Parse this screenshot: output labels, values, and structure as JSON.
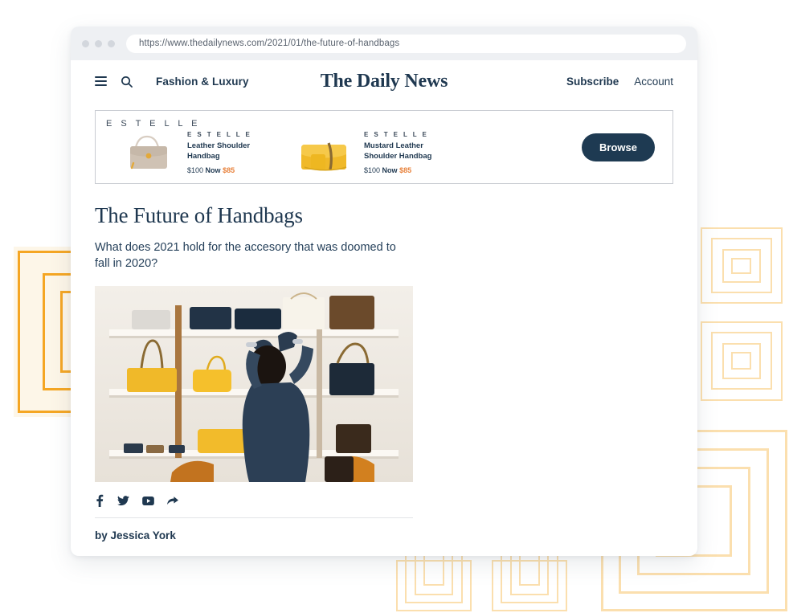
{
  "browser": {
    "url": "https://www.thedailynews.com/2021/01/the-future-of-handbags",
    "dots": [
      "close-dot",
      "minimize-dot",
      "maximize-dot"
    ]
  },
  "header": {
    "menu_icon": "hamburger-icon",
    "search_icon": "search-icon",
    "section_label": "Fashion & Luxury",
    "masthead": "The Daily News",
    "subscribe_label": "Subscribe",
    "account_label": "Account"
  },
  "ad": {
    "brand_header": "E S T E L L E",
    "products": [
      {
        "brand": "E S T E L L E",
        "title": "Leather Shoulder Handbag",
        "price_old": "$100",
        "price_now_label": "Now",
        "price_new": "$85",
        "color": "#cfc2b4"
      },
      {
        "brand": "E S T E L L E",
        "title": "Mustard Leather Shoulder Handbag",
        "price_old": "$100",
        "price_now_label": "Now",
        "price_new": "$85",
        "color": "#f0b929"
      }
    ],
    "cta_label": "Browse"
  },
  "article": {
    "headline": "The Future of Handbags",
    "subtitle": "What does 2021 hold for the accesory that was doomed to fall in 2020?",
    "photo_alt": "Woman reaching for handbags on white retail shelves",
    "social": [
      {
        "name": "facebook-icon",
        "glyph": "f"
      },
      {
        "name": "twitter-icon",
        "glyph": "twitter"
      },
      {
        "name": "youtube-icon",
        "glyph": "youtube"
      },
      {
        "name": "share-icon",
        "glyph": "share"
      }
    ],
    "byline": "by Jessica York"
  },
  "colors": {
    "navy": "#1f3850",
    "accent_orange": "#f5a623",
    "accent_orange_faint": "#fbdfae",
    "sale_orange": "#e8823c",
    "cream": "#fdf6e8",
    "chrome_grey": "#eef0f3"
  },
  "decor": {
    "motifs": [
      {
        "name": "motif-left-large",
        "rings": 5,
        "style": "solid"
      },
      {
        "name": "motif-right-upper",
        "rings": 4,
        "style": "faint"
      },
      {
        "name": "motif-right-lower",
        "rings": 4,
        "style": "faint"
      },
      {
        "name": "motif-bottom-left-small",
        "rings": 4,
        "style": "faint"
      },
      {
        "name": "motif-bottom-mid-small",
        "rings": 4,
        "style": "faint"
      },
      {
        "name": "motif-bottom-right-large",
        "rings": 4,
        "style": "faint"
      }
    ]
  }
}
